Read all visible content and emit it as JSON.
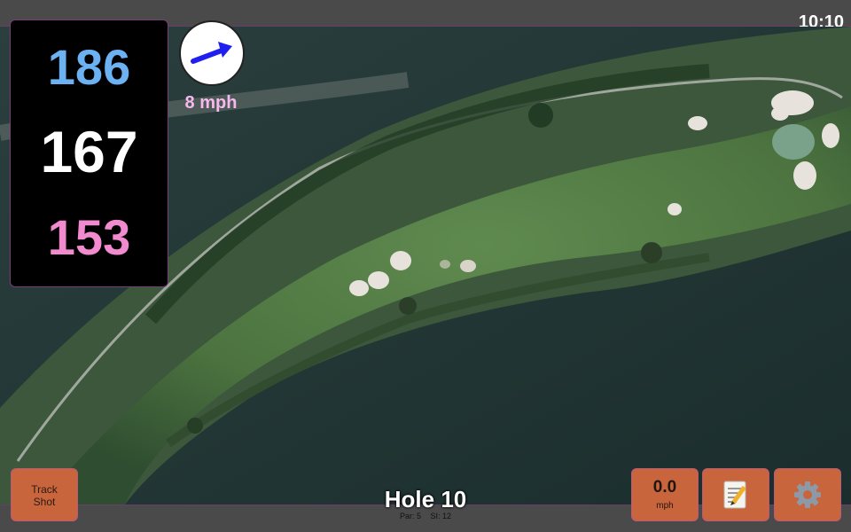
{
  "status": {
    "time": "10:10"
  },
  "distances": {
    "back": "186",
    "middle": "167",
    "front": "153"
  },
  "wind": {
    "speed_label": "8 mph",
    "arrow_color": "#1f1ff0"
  },
  "hole": {
    "title": "Hole 10",
    "par": "Par: 5",
    "stroke_index": "SI: 12"
  },
  "buttons": {
    "track_shot_line1": "Track",
    "track_shot_line2": "Shot",
    "speed_value": "0.0",
    "speed_unit": "mph",
    "notes_icon": "notepad-icon",
    "settings_icon": "gear-icon"
  },
  "colors": {
    "back_distance": "#6cb2f2",
    "middle_distance": "#ffffff",
    "front_distance": "#f28ad0",
    "button_fill": "#c8653c",
    "bar": "#4a4a4a",
    "water": "#1e3433"
  }
}
